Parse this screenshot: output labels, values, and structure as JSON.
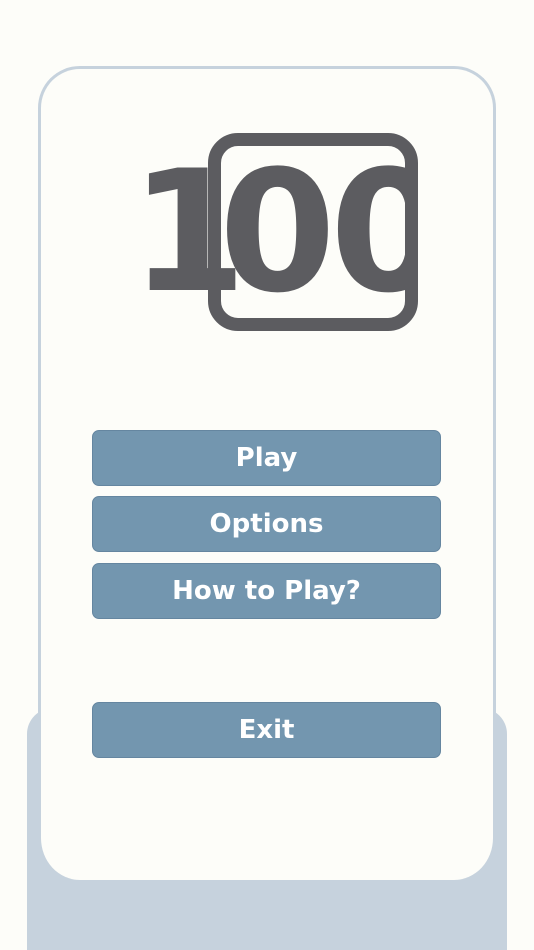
{
  "logo": {
    "digit_one": "1",
    "digits_zero": "00",
    "color": "#5c5c60"
  },
  "menu": {
    "play_label": "Play",
    "options_label": "Options",
    "how_to_play_label": "How to Play?",
    "exit_label": "Exit"
  },
  "colors": {
    "background": "#fdfdf9",
    "panel": "#c6d2dd",
    "button": "#7396af",
    "button_text": "#ffffff"
  }
}
